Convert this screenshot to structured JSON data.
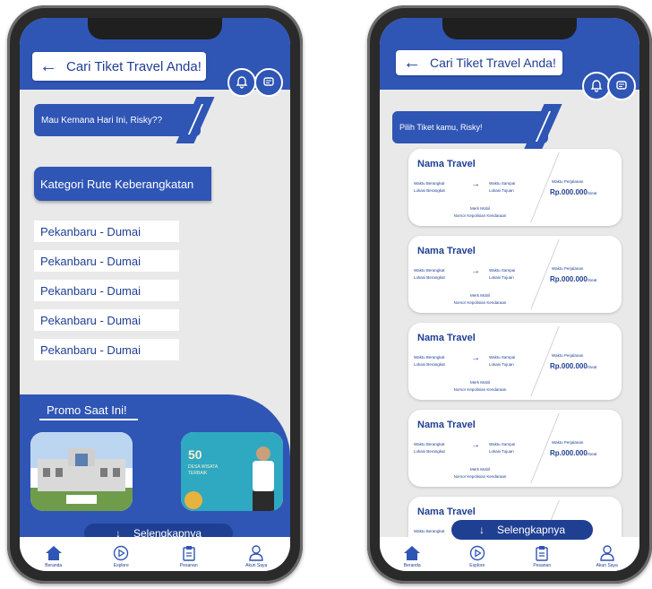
{
  "left_screen": {
    "header_title": "Cari Tiket Travel Anda!",
    "greeting": "Mau Kemana Hari Ini, Risky??",
    "category_title": "Kategori Rute Keberangkatan",
    "routes": [
      "Pekanbaru - Dumai",
      "Pekanbaru - Dumai",
      "Pekanbaru - Dumai",
      "Pekanbaru - Dumai",
      "Pekanbaru - Dumai"
    ],
    "promo_title": "Promo Saat Ini!",
    "promo2_text": "50\nDESA WISATA\nTERBAIK",
    "more_label": "Selengkapnya"
  },
  "right_screen": {
    "header_title": "Cari Tiket Travel Anda!",
    "greeting": "Pilih Tiket kamu, Risky!",
    "ticket": {
      "name": "Nama Travel",
      "depart_time": "Waktu Berangkat",
      "depart_location": "Lokasi Berangkat",
      "arrive_time": "Waktu Sampai",
      "arrive_location": "Lokasi Tujuan",
      "car_brand": "Merk Mobil",
      "plate": "Nomor Kepolisian Kendaraan",
      "duration": "Waktu Perjalanan",
      "price": "Rp.000.000",
      "per_seat": "/Seat"
    },
    "more_label": "Selengkapnya"
  },
  "tabs": [
    {
      "label": "Beranda",
      "icon": "home-icon"
    },
    {
      "label": "Explore",
      "icon": "play-icon"
    },
    {
      "label": "Pesanan",
      "icon": "clipboard-icon"
    },
    {
      "label": "Akun Saya",
      "icon": "user-icon"
    }
  ],
  "colors": {
    "primary": "#2f55b5",
    "dark": "#1f3f93",
    "screen_bg": "#e9e9e9"
  }
}
